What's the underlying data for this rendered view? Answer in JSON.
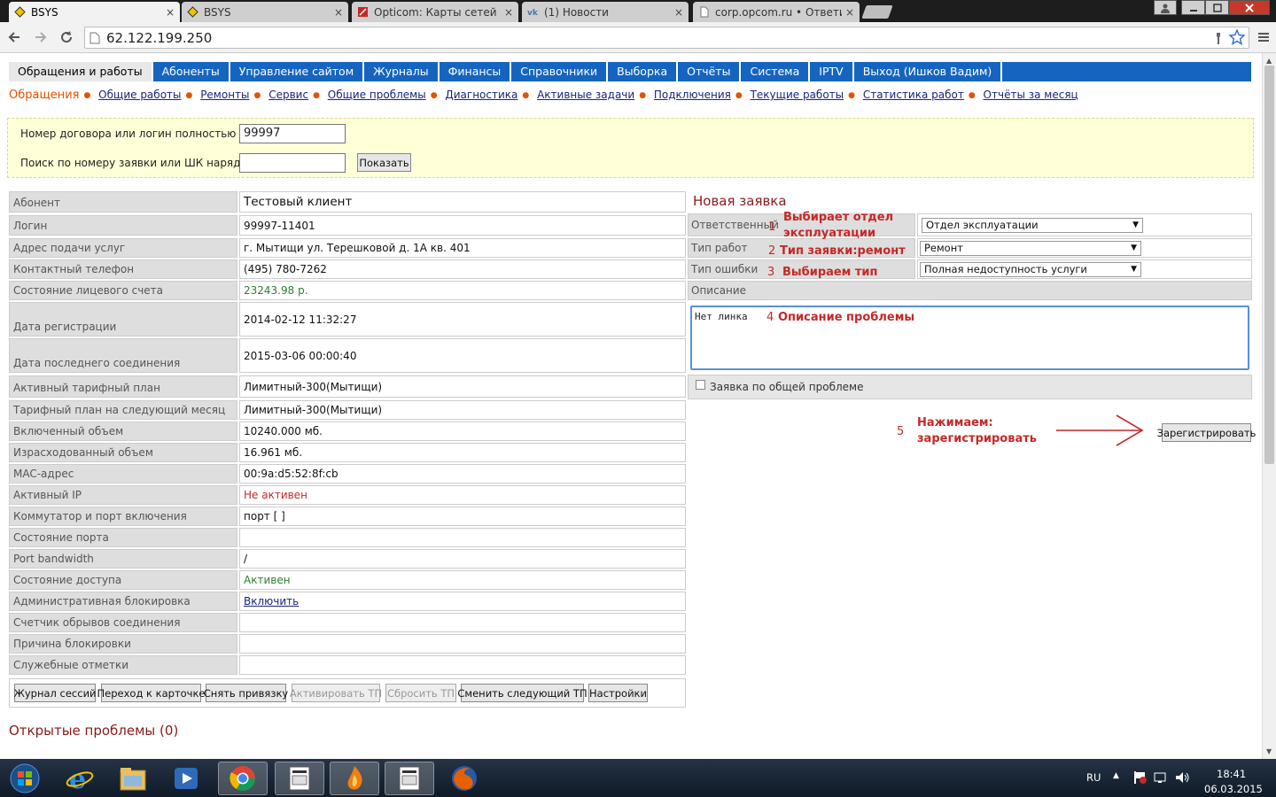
{
  "browser": {
    "tabs": [
      {
        "title": "BSYS",
        "icon": "bsys-icon",
        "active": true
      },
      {
        "title": "BSYS",
        "icon": "bsys-icon",
        "active": false
      },
      {
        "title": "Opticom: Карты сетей [об",
        "icon": "opticom-icon",
        "active": false
      },
      {
        "title": "(1) Новости",
        "icon": "vk-icon",
        "active": false
      },
      {
        "title": "corp.opcom.ru • Ответить",
        "icon": "page-icon",
        "active": false
      }
    ],
    "close_glyph": "×",
    "url": "62.122.199.250"
  },
  "menu": {
    "items": [
      "Обращения и работы",
      "Абоненты",
      "Управление сайтом",
      "Журналы",
      "Финансы",
      "Справочники",
      "Выборка",
      "Отчёты",
      "Система",
      "IPTV",
      "Выход (Ишков Вадим)"
    ],
    "active_index": 0,
    "color": "#1565c0"
  },
  "submenu": {
    "active": "Обращения",
    "items": [
      "Общие работы",
      "Ремонты",
      "Сервис",
      "Общие проблемы",
      "Диагностика",
      "Активные задачи",
      "Подключения",
      "Текущие работы",
      "Статистика работ",
      "Отчёты за месяц"
    ]
  },
  "search": {
    "contract_label": "Номер договора или логин полностью",
    "contract_value": "99997",
    "ticket_label": "Поиск по номеру заявки или ШК наряда",
    "ticket_value": "",
    "show_button": "Показать"
  },
  "subscriber": {
    "rows": [
      {
        "label": "Абонент",
        "value": "Тестовый клиент"
      },
      {
        "label": "Логин",
        "value": "99997-11401"
      },
      {
        "label": "Адрес подачи услуг",
        "value": "г. Мытищи ул. Терешковой д. 1А кв. 401"
      },
      {
        "label": "Контактный телефон",
        "value": "(495) 780-7262"
      },
      {
        "label": "Состояние лицевого счета",
        "value": "23243.98 р."
      },
      {
        "label": "Дата регистрации",
        "value": "2014-02-12 11:32:27"
      },
      {
        "label": "Дата последнего соединения",
        "value": "2015-03-06 00:00:40"
      },
      {
        "label": "Активный тарифный план",
        "value": "Лимитный-300(Мытищи)"
      },
      {
        "label": "Тарифный план на следующий месяц",
        "value": "Лимитный-300(Мытищи)"
      },
      {
        "label": "Включенный объем",
        "value": "10240.000 мб."
      },
      {
        "label": "Израсходованный объем",
        "value": "16.961 мб."
      },
      {
        "label": "MAC-адрес",
        "value": "00:9a:d5:52:8f:cb"
      },
      {
        "label": "Активный IP",
        "value": "Не активен"
      },
      {
        "label": "Коммутатор и порт включения",
        "value": "порт [ ]"
      },
      {
        "label": "Состояние порта",
        "value": ""
      },
      {
        "label": "Port bandwidth",
        "value": "/"
      },
      {
        "label": "Состояние доступа",
        "value": "Активен"
      },
      {
        "label": "Административная блокировка",
        "value": "Включить"
      },
      {
        "label": "Счетчик обрывов соединения",
        "value": ""
      },
      {
        "label": "Причина блокировки",
        "value": ""
      },
      {
        "label": "Служебные отметки",
        "value": ""
      }
    ],
    "buttons": [
      {
        "label": "Журнал сессий",
        "enabled": true
      },
      {
        "label": "Переход к карточке",
        "enabled": true
      },
      {
        "label": "Снять привязку",
        "enabled": true
      },
      {
        "label": "Активировать ТП",
        "enabled": false
      },
      {
        "label": "Сбросить ТП",
        "enabled": false
      },
      {
        "label": "Сменить следующий ТП",
        "enabled": true
      },
      {
        "label": "Настройки",
        "enabled": true
      }
    ]
  },
  "ticket": {
    "title": "Новая заявка",
    "responsible_label": "Ответственный",
    "responsible_value": "Отдел эксплуатации",
    "work_type_label": "Тип работ",
    "work_type_value": "Ремонт",
    "error_type_label": "Тип ошибки",
    "error_type_value": "Полная недоступность услуги",
    "description_label": "Описание",
    "description_value": "Нет линка",
    "general_problem_label": "Заявка по общей проблеме",
    "general_problem_checked": false,
    "submit_button": "Зарегистрировать",
    "select_arrow": "▼"
  },
  "annotations": [
    {
      "num": "1",
      "text_line1": "Выбирает отдел",
      "text_line2": "эксплуатации"
    },
    {
      "num": "2",
      "text": "Тип заявки:ремонт"
    },
    {
      "num": "3",
      "text": "Выбираем тип"
    },
    {
      "num": "4",
      "text": "Описание проблемы"
    },
    {
      "num": "5",
      "text_line1": "Нажимаем:",
      "text_line2": "зарегистрировать"
    }
  ],
  "annotation_color": "#c62828",
  "open_problems": "Открытые проблемы (0)",
  "taskbar": {
    "lang": "RU",
    "time": "18:41",
    "date": "06.03.2015",
    "apps": [
      "start-button",
      "ie-icon",
      "explorer-icon",
      "media-player-icon",
      "chrome-icon",
      "app-window-icon",
      "thunder-icon",
      "app-window-icon",
      "firefox-icon"
    ]
  }
}
